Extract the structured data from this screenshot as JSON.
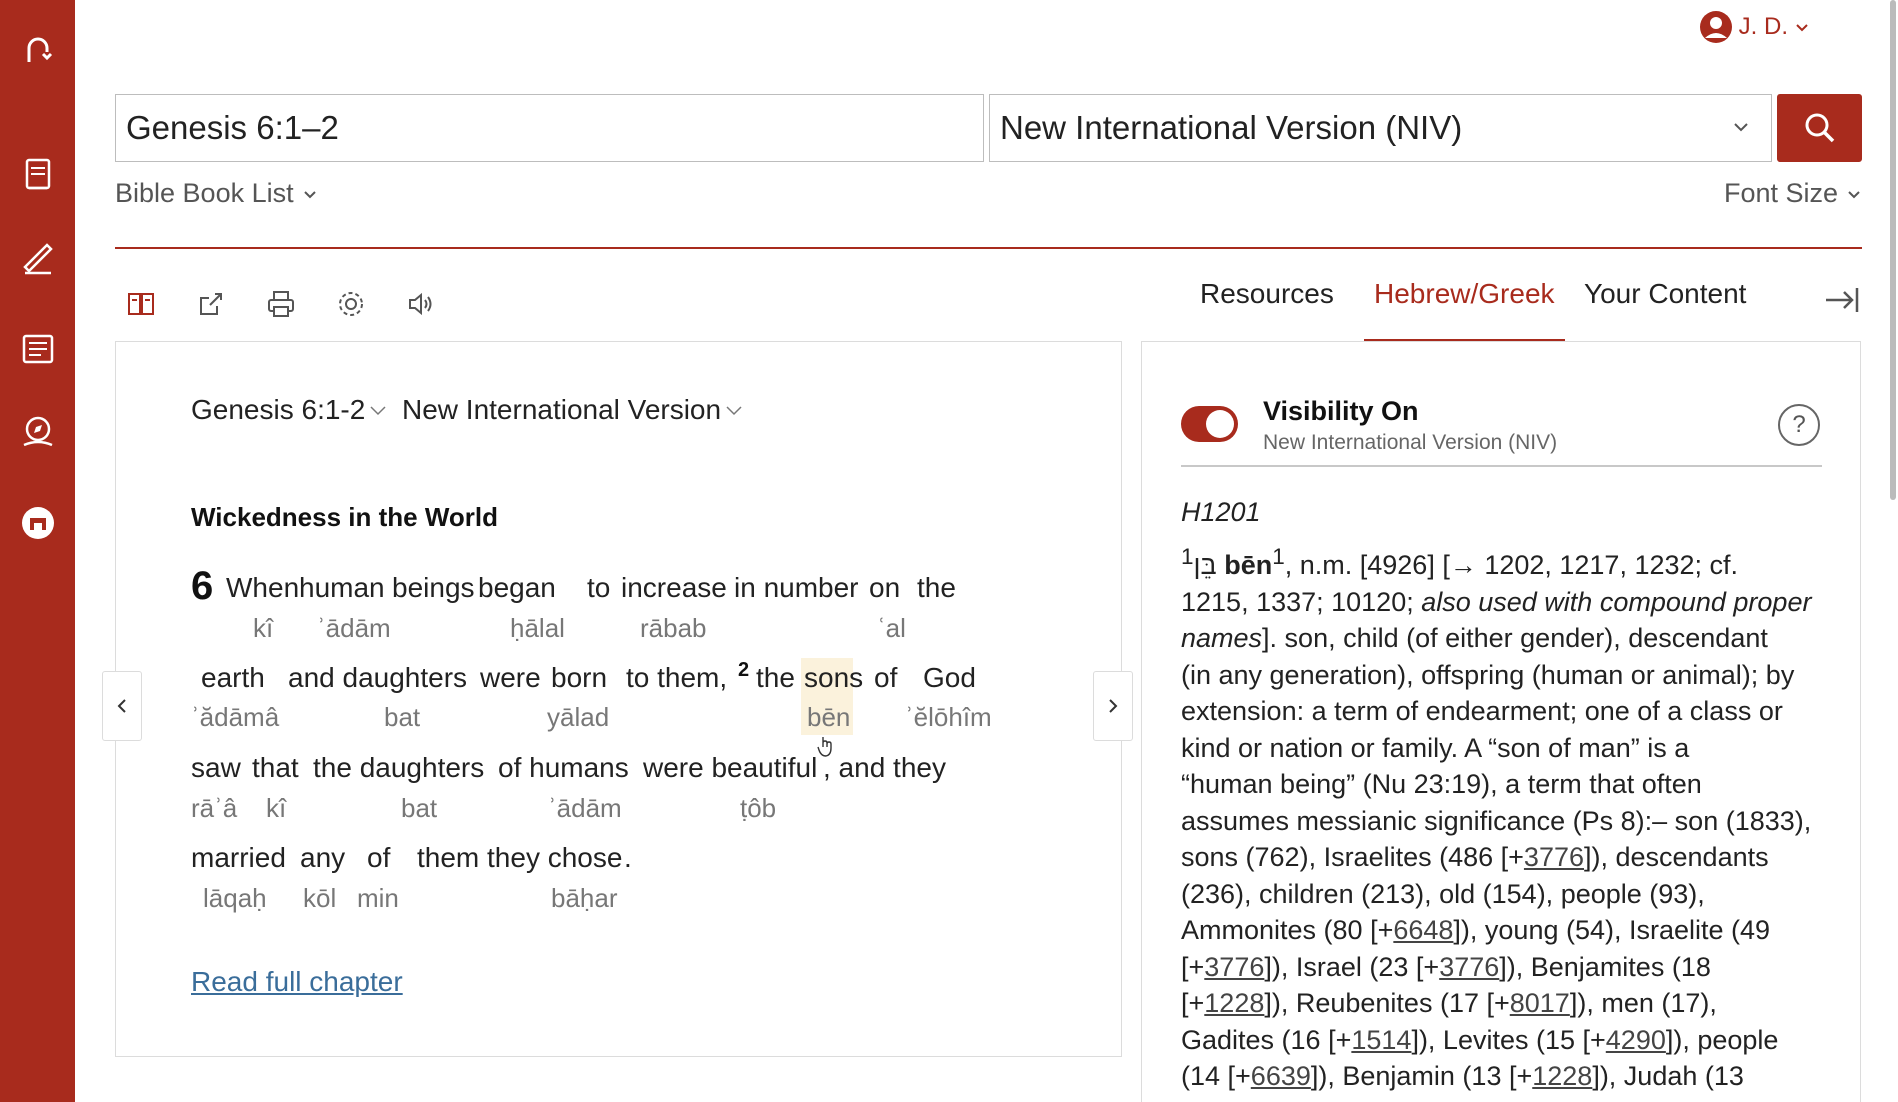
{
  "user": {
    "name": "J. D."
  },
  "search": {
    "reference": "Genesis 6:1–2",
    "version": "New International Version (NIV)"
  },
  "links": {
    "bible_book_list": "Bible Book List",
    "font_size": "Font Size"
  },
  "tabs": {
    "resources": "Resources",
    "hebrew_greek": "Hebrew/Greek",
    "your_content": "Your Content",
    "active": "Hebrew/Greek"
  },
  "reader": {
    "passage": "Genesis 6:1-2",
    "version": "New International Version",
    "section_title": "Wickedness in the World",
    "chapter_number": "6",
    "verse2_number": "2",
    "highlight_word": "sons",
    "read_full_chapter": "Read full chapter",
    "words": {
      "w1": "When",
      "w2": "human",
      "w3": "beings",
      "w4": "began",
      "w5": "to",
      "w6": "increase",
      "w7": "in number",
      "w8": "on",
      "w9": "the",
      "w10": "earth",
      "w11": "and daughters",
      "w12": "were",
      "w13": "born",
      "w14": "to them,",
      "w15": "the",
      "w16": "sons",
      "w17": "of",
      "w18": "God",
      "w19": "saw",
      "w20": "that",
      "w21": "the daughters",
      "w22": "of humans",
      "w23": "were beautiful",
      "w24": ", and they",
      "w25": "married",
      "w26": "any",
      "w27": "of",
      "w28": "them they chose",
      "w29": "."
    },
    "translit": {
      "t1": "kî",
      "t2": "ʾādām",
      "t3": "ḥālal",
      "t4": "rābab",
      "t5": "ʿal",
      "t6": "ʾădāmâ",
      "t7": "bat",
      "t8": "yālad",
      "t9": "bēn",
      "t10": "ʾĕlōhîm",
      "t11": "rāʾâ",
      "t12": "kî",
      "t13": "bat",
      "t14": "ʾādām",
      "t15": "ṭôb",
      "t16": "lāqaḥ",
      "t17": "kōl",
      "t18": "min",
      "t19": "bāḥar"
    }
  },
  "panel": {
    "visibility_title": "Visibility On",
    "visibility_sub": "New International Version (NIV)",
    "help": "?",
    "strongs": "H1201",
    "def": {
      "l1_sup": "1",
      "l1_hebrew": "בֵּן",
      "l1_word": "bēn",
      "l1_sup2": "1",
      "l1_rest": ", n.m. [4926] [→ 1202, 1217, 1232; cf.",
      "l2_a": "1215, 1337; 10120; ",
      "l2_em": "also used with compound proper",
      "l3_em": "names",
      "l3_rest": "]. son, child (of either gender), descendant",
      "l4": "(in any generation), offspring (human or animal); by",
      "l5": "extension: a term of endearment; one of a class or",
      "l6": "kind or nation or family. A “son of man” is a",
      "l7": "“human being” (Nu 23:19), a term that often",
      "l8": "assumes messianic significance (Ps 8):– son (1833),",
      "l9_a": "sons (762), Israelites (486 [+",
      "l9_link": "3776",
      "l9_b": "]), descendants",
      "l10": "(236), children (213), old (154), people (93),",
      "l11_a": "Ammonites (80 [+",
      "l11_link": "6648",
      "l11_b": "]), young (54), Israelite (49",
      "l12_a": "[+",
      "l12_link1": "3776",
      "l12_b": "]), Israel (23 [+",
      "l12_link2": "3776",
      "l12_c": "]), Benjamites (18",
      "l13_a": "[+",
      "l13_link1": "1228",
      "l13_b": "]), Reubenites (17 [+",
      "l13_link2": "8017",
      "l13_c": "]), men (17),",
      "l14_a": "Gadites (16 [+",
      "l14_link1": "1514",
      "l14_b": "]), Levites (15 [+",
      "l14_link2": "4290",
      "l14_c": "]), people",
      "l15_a": "(14 [+",
      "l15_link1": "6639",
      "l15_b": "]), Benjamin (13 [+",
      "l15_link2": "1228",
      "l15_c": "]), Judah (13"
    }
  },
  "colors": {
    "accent": "#a82b1d",
    "link": "#3a6d9a",
    "highlight": "#fbf2dc"
  }
}
